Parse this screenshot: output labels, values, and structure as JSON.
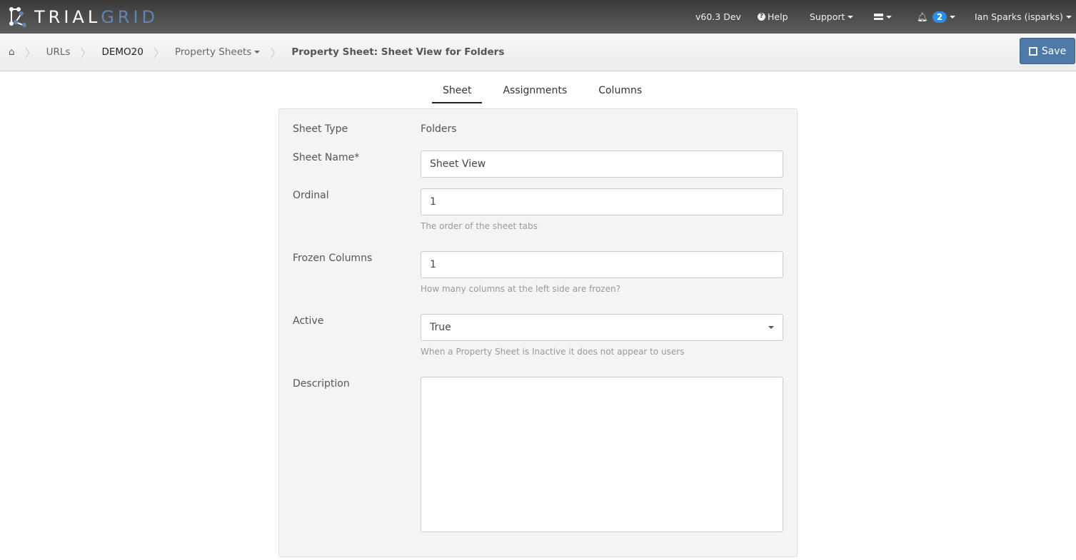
{
  "brand": {
    "part1": "TRIAL",
    "part2": "GRID"
  },
  "topnav": {
    "version": "v60.3 Dev",
    "help": "Help",
    "support": "Support",
    "notifications_count": "2",
    "user": "Ian Sparks (isparks)"
  },
  "breadcrumb": {
    "items": [
      "URLs",
      "DEMO20",
      "Property Sheets"
    ],
    "current": "Property Sheet: Sheet View for Folders"
  },
  "toolbar": {
    "save_label": "Save"
  },
  "tabs": [
    {
      "label": "Sheet",
      "active": true
    },
    {
      "label": "Assignments"
    },
    {
      "label": "Columns"
    }
  ],
  "form": {
    "sheet_type": {
      "label": "Sheet Type",
      "value": "Folders"
    },
    "sheet_name": {
      "label": "Sheet Name*",
      "value": "Sheet View"
    },
    "ordinal": {
      "label": "Ordinal",
      "value": "1",
      "help": "The order of the sheet tabs"
    },
    "frozen": {
      "label": "Frozen Columns",
      "value": "1",
      "help": "How many columns at the left side are frozen?"
    },
    "active": {
      "label": "Active",
      "value": "True",
      "help": "When a Property Sheet is Inactive it does not appear to users"
    },
    "description": {
      "label": "Description",
      "value": ""
    }
  }
}
